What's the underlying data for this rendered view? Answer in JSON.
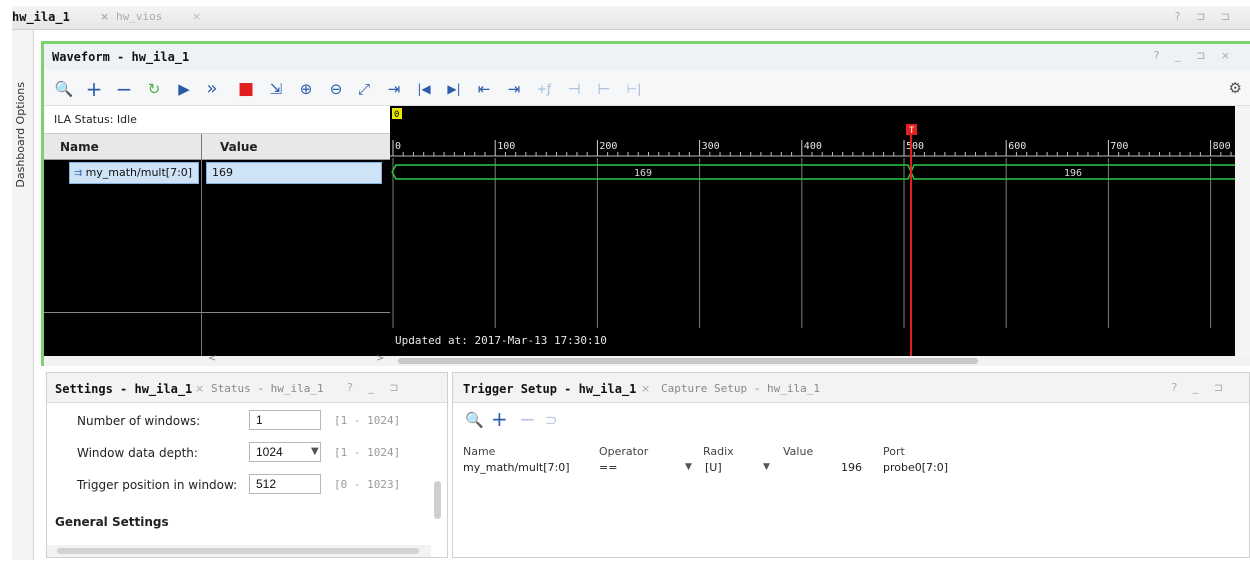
{
  "top_tabs": {
    "active": "hw_ila_1",
    "inactive": "hw_vios",
    "close": "×",
    "controls": "? ⊐ ⊐"
  },
  "side_tab": {
    "label": "Dashboard Options"
  },
  "waveform": {
    "title": "Waveform - hw_ila_1",
    "controls": "? _ ⊐ ×",
    "toolbar": {
      "search": "🔍",
      "add": "+",
      "remove": "−",
      "run_trigger": "↻",
      "run": "▶",
      "run_immediate": "»",
      "stop": "■",
      "export": "⇲",
      "zoom_in": "⊕",
      "zoom_out": "⊖",
      "zoom_fit": "⤢",
      "goto_cursor": "⇥",
      "goto_start": "|◀",
      "goto_end": "▶|",
      "prev_transition": "⇤",
      "next_transition": "⇥",
      "add_marker": "+ƒ",
      "prev_marker": "⊣",
      "next_marker": "⊢",
      "remove_markers": "⊢|",
      "settings": "⚙"
    },
    "ila_status": "ILA Status: Idle",
    "columns": {
      "name": "Name",
      "value": "Value"
    },
    "rows": [
      {
        "name": "my_math/mult[7:0]",
        "value": "169"
      }
    ],
    "axis_ticks": [
      "0",
      "100",
      "200",
      "300",
      "400",
      "500",
      "600",
      "700",
      "800"
    ],
    "trigger_marker_label": "T",
    "origin_marker_label": "0",
    "segments": [
      {
        "value": "169"
      },
      {
        "value": "196"
      }
    ],
    "updated": "Updated at: 2017-Mar-13 17:30:10",
    "scroll_left": "<",
    "scroll_right": ">"
  },
  "settings": {
    "tab_active": "Settings - hw_ila_1",
    "tab_inactive": "Status - hw_ila_1",
    "close": "×",
    "controls": "? _ ⊐",
    "fields": [
      {
        "label": "Number of windows:",
        "value": "1",
        "range": "[1 - 1024]"
      },
      {
        "label": "Window data depth:",
        "value": "1024",
        "range": "[1 - 1024]"
      },
      {
        "label": "Trigger position in window:",
        "value": "512",
        "range": "[0 - 1023]"
      }
    ],
    "general": "General Settings"
  },
  "trigger": {
    "tab_active": "Trigger Setup - hw_ila_1",
    "tab_inactive": "Capture Setup - hw_ila_1",
    "close": "×",
    "controls": "? _ ⊐",
    "toolbar": {
      "search": "🔍",
      "add": "+",
      "remove": "−",
      "gate": "⊃"
    },
    "headers": {
      "name": "Name",
      "operator": "Operator",
      "radix": "Radix",
      "value": "Value",
      "port": "Port"
    },
    "rows": [
      {
        "name": "my_math/mult[7:0]",
        "operator": "==",
        "radix": "[U]",
        "value": "196",
        "port": "probe0[7:0]"
      }
    ]
  },
  "colors": {
    "accent_green": "#7ad36b",
    "waveform_bg": "#000000",
    "bus_green": "#2ecc40",
    "trigger_red": "#e21e1e",
    "selection": "#cfe3f6"
  }
}
